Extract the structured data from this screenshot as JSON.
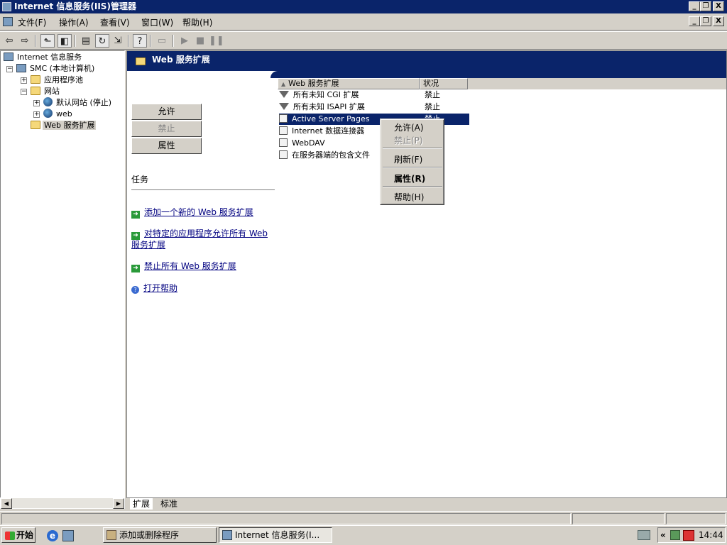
{
  "window": {
    "title": "Internet 信息服务(IIS)管理器",
    "controls": {
      "minimize": "_",
      "restore": "❐",
      "close": "X"
    }
  },
  "menu": [
    "文件(F)",
    "操作(A)",
    "查看(V)",
    "窗口(W)",
    "帮助(H)"
  ],
  "toolbar": {
    "back_icon": "arrow-left-icon",
    "forward_icon": "arrow-right-icon"
  },
  "tree": {
    "root": "Internet 信息服务",
    "computer": "SMC (本地计算机)",
    "app_pools": "应用程序池",
    "websites": "网站",
    "default_site": "默认网站 (停止)",
    "web": "web",
    "web_ext": "Web 服务扩展"
  },
  "panel": {
    "banner_title": "Web 服务扩展",
    "buttons": {
      "allow": "允许",
      "deny": "禁止",
      "properties": "属性"
    },
    "tasks_header": "任务",
    "tasks": {
      "add_new": "添加一个新的 Web 服务扩展",
      "allow_all_line1": "对特定的应用程序允许所有 Web",
      "allow_all_line2": "服务扩展",
      "deny_all": "禁止所有 Web 服务扩展",
      "open_help": "打开帮助"
    }
  },
  "list": {
    "columns": [
      "Web 服务扩展",
      "状况"
    ],
    "rows": [
      {
        "name": "所有未知 CGI 扩展",
        "status": "禁止"
      },
      {
        "name": "所有未知 ISAPI 扩展",
        "status": "禁止"
      },
      {
        "name": "Active Server Pages",
        "status": "禁止"
      },
      {
        "name": "Internet 数据连接器",
        "status": ""
      },
      {
        "name": "WebDAV",
        "status": ""
      },
      {
        "name": "在服务器端的包含文件",
        "status": ""
      }
    ]
  },
  "context_menu": {
    "allow": "允许(A)",
    "deny": "禁止(P)",
    "refresh": "刷新(F)",
    "properties": "属性(R)",
    "help": "帮助(H)"
  },
  "tabs": [
    "扩展",
    "标准"
  ],
  "taskbar": {
    "start": "开始",
    "items": [
      "添加或删除程序",
      "Internet 信息服务(I..."
    ],
    "time": "14:44",
    "tray_chevron": "«"
  }
}
